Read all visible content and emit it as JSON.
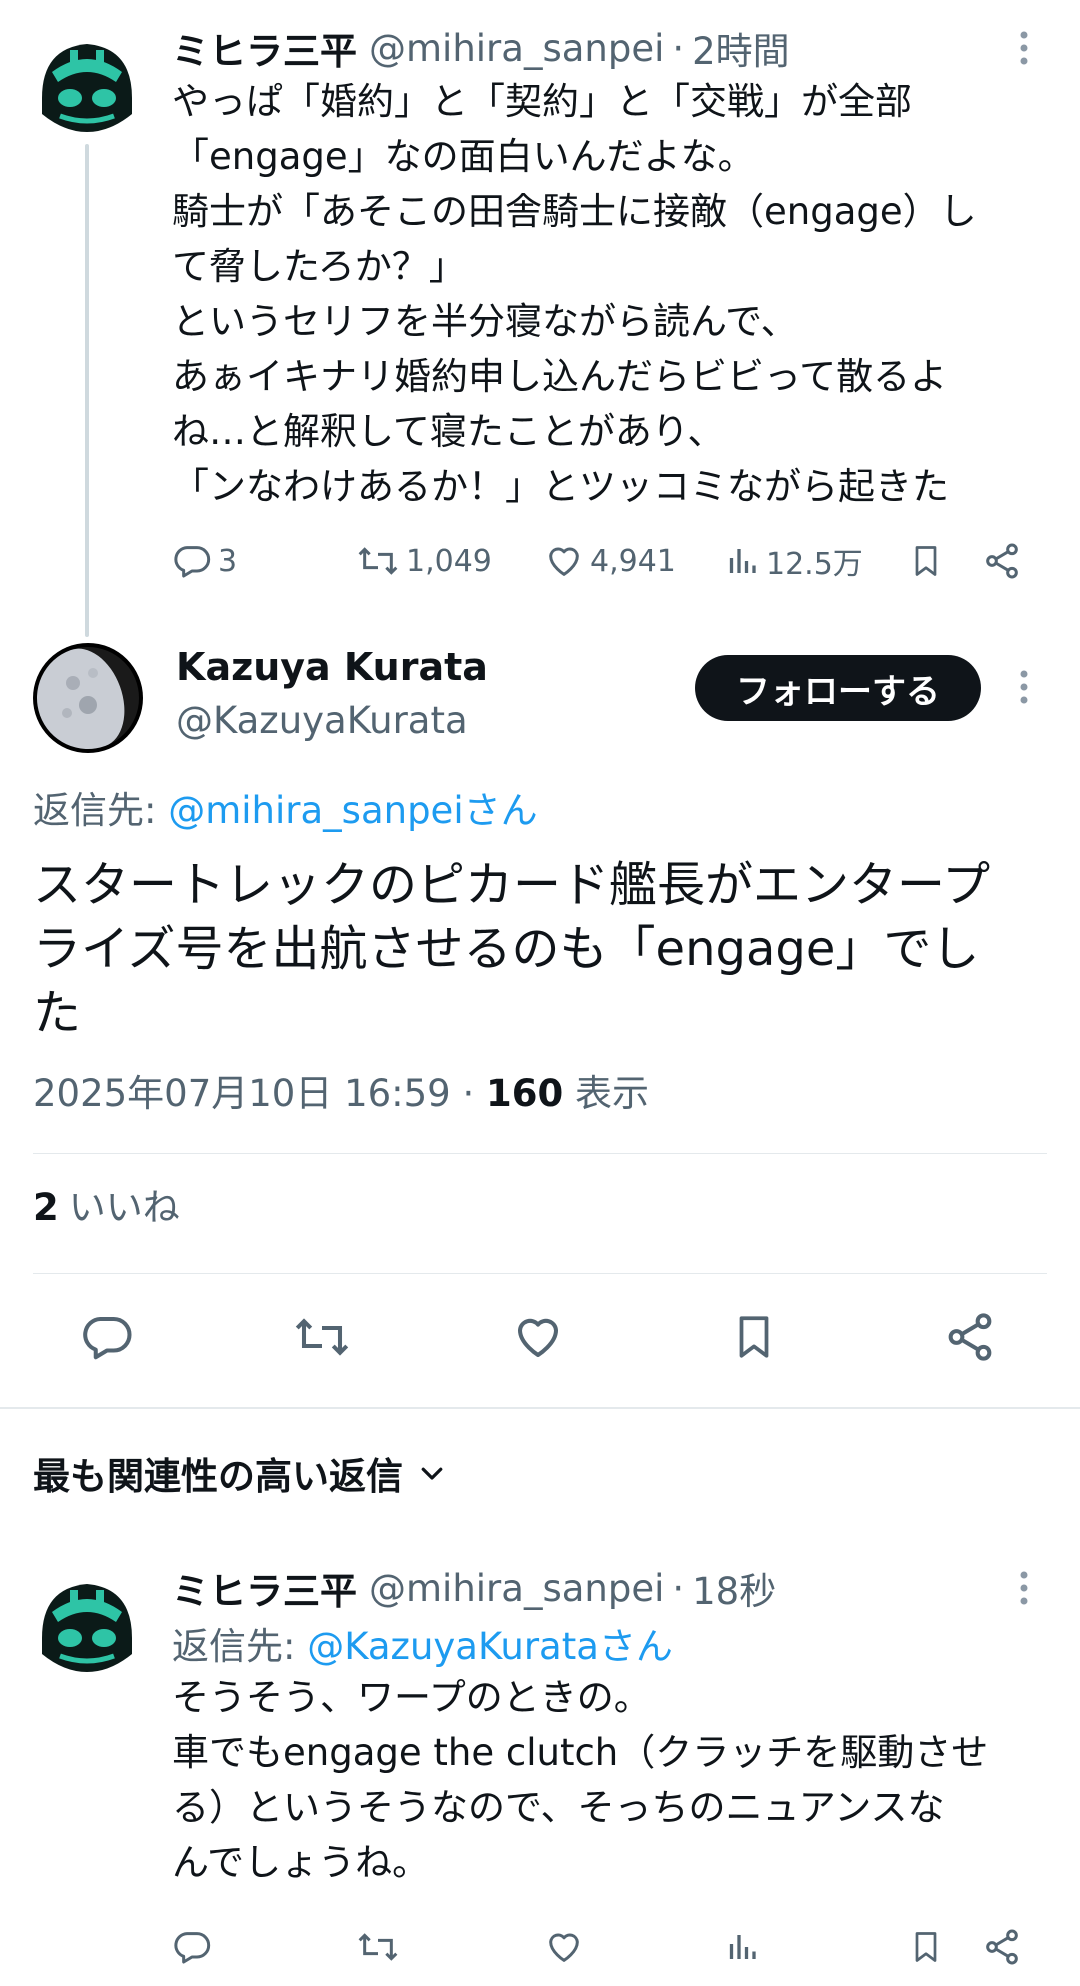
{
  "tweet1": {
    "name": "ミヒラ三平",
    "handle": "@mihira_sanpei",
    "separator": "·",
    "time": "2時間",
    "text": "やっぱ「婚約」と「契約」と「交戦」が全部\n「engage」なの面白いんだよな。\n騎士が「あそこの田舎騎士に接敵（engage）し\nて脅したろか？」\nというセリフを半分寝ながら読んで、\nあぁイキナリ婚約申し込んだらビビって散るよ\nね…と解釈して寝たことがあり、\n「ンなわけあるか！」とツッコミながら起きた",
    "replies": "3",
    "retweets": "1,049",
    "likes": "4,941",
    "views": "12.5万"
  },
  "main_tweet": {
    "name": "Kazuya Kurata",
    "handle": "@KazuyaKurata",
    "follow_label": "フォローする",
    "reply_prefix": "返信先: ",
    "reply_to": "@mihira_sanpeiさん",
    "text": "スタートレックのピカード艦長がエンタープ\nライズ号を出航させるのも「engage」でし\nた",
    "timestamp": "2025年07月10日 16:59",
    "separator": " · ",
    "views_count": "160",
    "views_label": " 表示",
    "likes_count": "2",
    "likes_label": "いいね"
  },
  "replies_section": {
    "sort_label": "最も関連性の高い返信"
  },
  "reply_tweet": {
    "name": "ミヒラ三平",
    "handle": "@mihira_sanpei",
    "separator": "·",
    "time": "18秒",
    "reply_prefix": "返信先: ",
    "reply_to": "@KazuyaKurataさん",
    "text": "そうそう、ワープのときの。\n車でもengage the clutch（クラッチを駆動させ\nる）というそうなので、そっちのニュアンスな\nんでしょうね。"
  },
  "colors": {
    "text": "#0f1419",
    "muted": "#536471",
    "link": "#1d9bf0",
    "follow_bg": "#0f1419",
    "avatar_teal": "#2ec4a6"
  },
  "icons": {
    "reply": "speech-bubble-icon",
    "retweet": "retweet-arrows-icon",
    "like": "heart-outline-icon",
    "views": "bar-chart-icon",
    "bookmark": "bookmark-icon",
    "share": "share-nodes-icon",
    "more": "vertical-dots-icon",
    "chevron": "chevron-down-icon"
  }
}
